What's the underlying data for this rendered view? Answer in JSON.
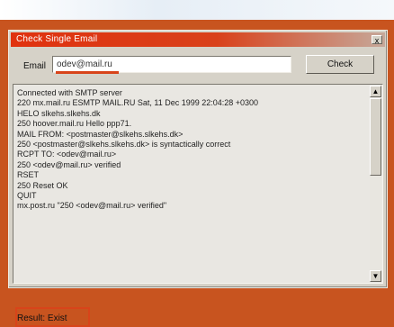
{
  "window": {
    "title": "Check Single Email",
    "close_glyph": "x"
  },
  "email": {
    "label": "Email",
    "value": "odev@mail.ru",
    "accent": "#d8441a"
  },
  "check_button": {
    "label": "Check"
  },
  "log": {
    "lines": [
      "Connected with SMTP server",
      "220 mx.mail.ru ESMTP MAIL.RU Sat, 11 Dec 1999 22:04:28 +0300",
      "HELO slkehs.slkehs.dk",
      "250 hoover.mail.ru Hello ppp71.",
      "MAIL FROM: <postmaster@slkehs.slkehs.dk>",
      "250 <postmaster@slkehs.slkehs.dk> is syntactically correct",
      "RCPT TO: <odev@mail.ru>",
      "250 <odev@mail.ru> verified",
      "RSET",
      "250 Reset OK",
      "QUIT",
      "mx.post.ru \"250 <odev@mail.ru> verified\""
    ]
  },
  "result": {
    "label": "Result: Exist"
  },
  "colors": {
    "background": "#c8541f",
    "titlebar": "#e0320f",
    "highlight": "#d8441a"
  },
  "icons": {
    "scroll_up": "arrow-up-icon",
    "scroll_down": "arrow-down-icon"
  }
}
